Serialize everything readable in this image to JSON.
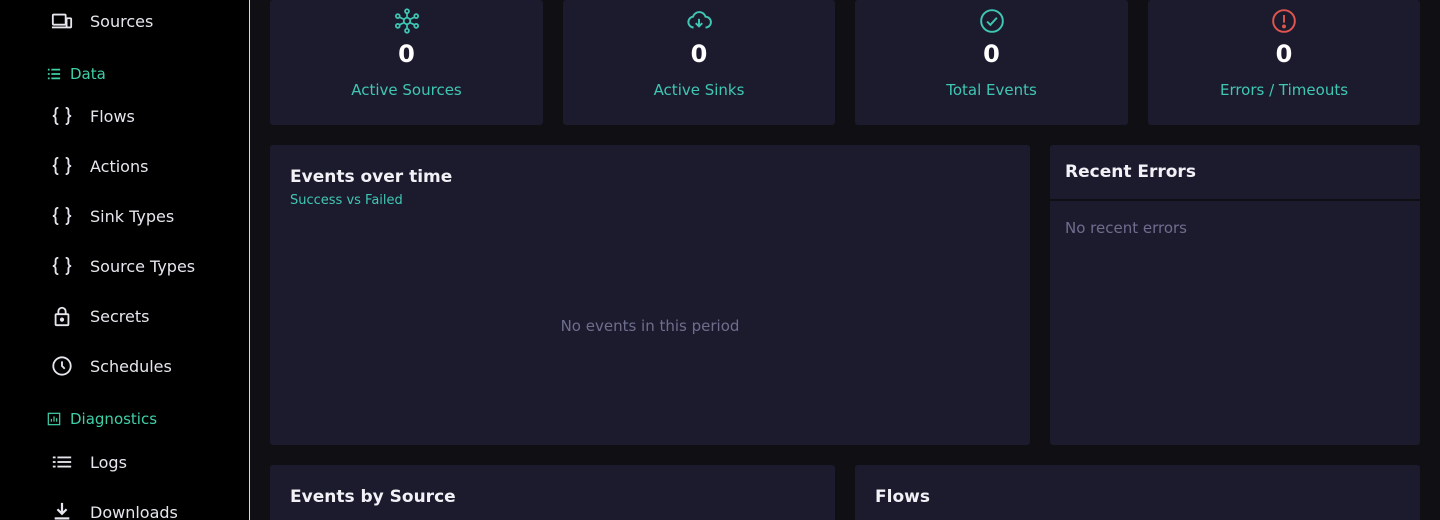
{
  "sidebar": {
    "items_top": [
      {
        "label": "Sources",
        "icon": "devices-icon"
      }
    ],
    "data_section": {
      "label": "Data",
      "icon": "list-icon"
    },
    "data_items": [
      {
        "label": "Flows",
        "icon": "braces-icon"
      },
      {
        "label": "Actions",
        "icon": "braces-icon"
      },
      {
        "label": "Sink Types",
        "icon": "braces-icon"
      },
      {
        "label": "Source Types",
        "icon": "braces-icon"
      },
      {
        "label": "Secrets",
        "icon": "lock-icon"
      },
      {
        "label": "Schedules",
        "icon": "clock-icon"
      }
    ],
    "diagnostics_section": {
      "label": "Diagnostics",
      "icon": "chart-icon"
    },
    "diagnostics_items": [
      {
        "label": "Logs",
        "icon": "list-icon"
      },
      {
        "label": "Downloads",
        "icon": "download-icon"
      }
    ]
  },
  "stats": [
    {
      "value": "0",
      "label": "Active Sources",
      "icon": "hub-icon",
      "color": "#3fc7b3"
    },
    {
      "value": "0",
      "label": "Active Sinks",
      "icon": "cloud-download-icon",
      "color": "#3fc7b3"
    },
    {
      "value": "0",
      "label": "Total Events",
      "icon": "check-circle-icon",
      "color": "#3fc7b3"
    },
    {
      "value": "0",
      "label": "Errors / Timeouts",
      "icon": "alert-circle-icon",
      "color": "#e0564f"
    }
  ],
  "events_chart": {
    "title": "Events over time",
    "subtitle": "Success vs Failed",
    "empty": "No events in this period"
  },
  "recent_errors": {
    "title": "Recent Errors",
    "empty": "No recent errors"
  },
  "events_by_source": {
    "title": "Events by Source"
  },
  "flows_panel": {
    "title": "Flows"
  },
  "colors": {
    "accent": "#3fc7b3",
    "error": "#e0564f",
    "card": "#1c1b2e"
  }
}
